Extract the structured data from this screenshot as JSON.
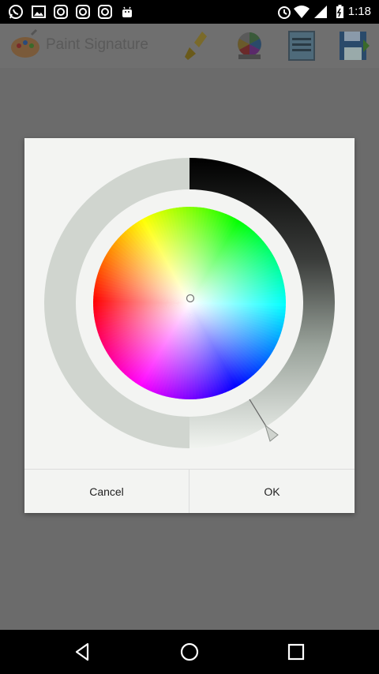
{
  "status_bar": {
    "time": "1:18",
    "left_icons": [
      "whatsapp-icon",
      "image-icon",
      "instagram-icon",
      "instagram-icon",
      "instagram-icon",
      "android-icon"
    ],
    "right_icons": [
      "alarm-icon",
      "wifi-icon",
      "signal-icon",
      "battery-icon"
    ]
  },
  "app_bar": {
    "title": "Paint Signature",
    "actions": [
      "brush-icon",
      "color-wheel-icon",
      "menu-list-icon",
      "save-icon"
    ]
  },
  "dialog": {
    "cancel_label": "Cancel",
    "ok_label": "OK",
    "colors": {
      "background": "#f3f4f2",
      "ring_left": "#d0d5cf",
      "ring_dark": "#000000"
    }
  },
  "nav_bar": {
    "buttons": [
      "back-icon",
      "home-icon",
      "recents-icon"
    ]
  }
}
